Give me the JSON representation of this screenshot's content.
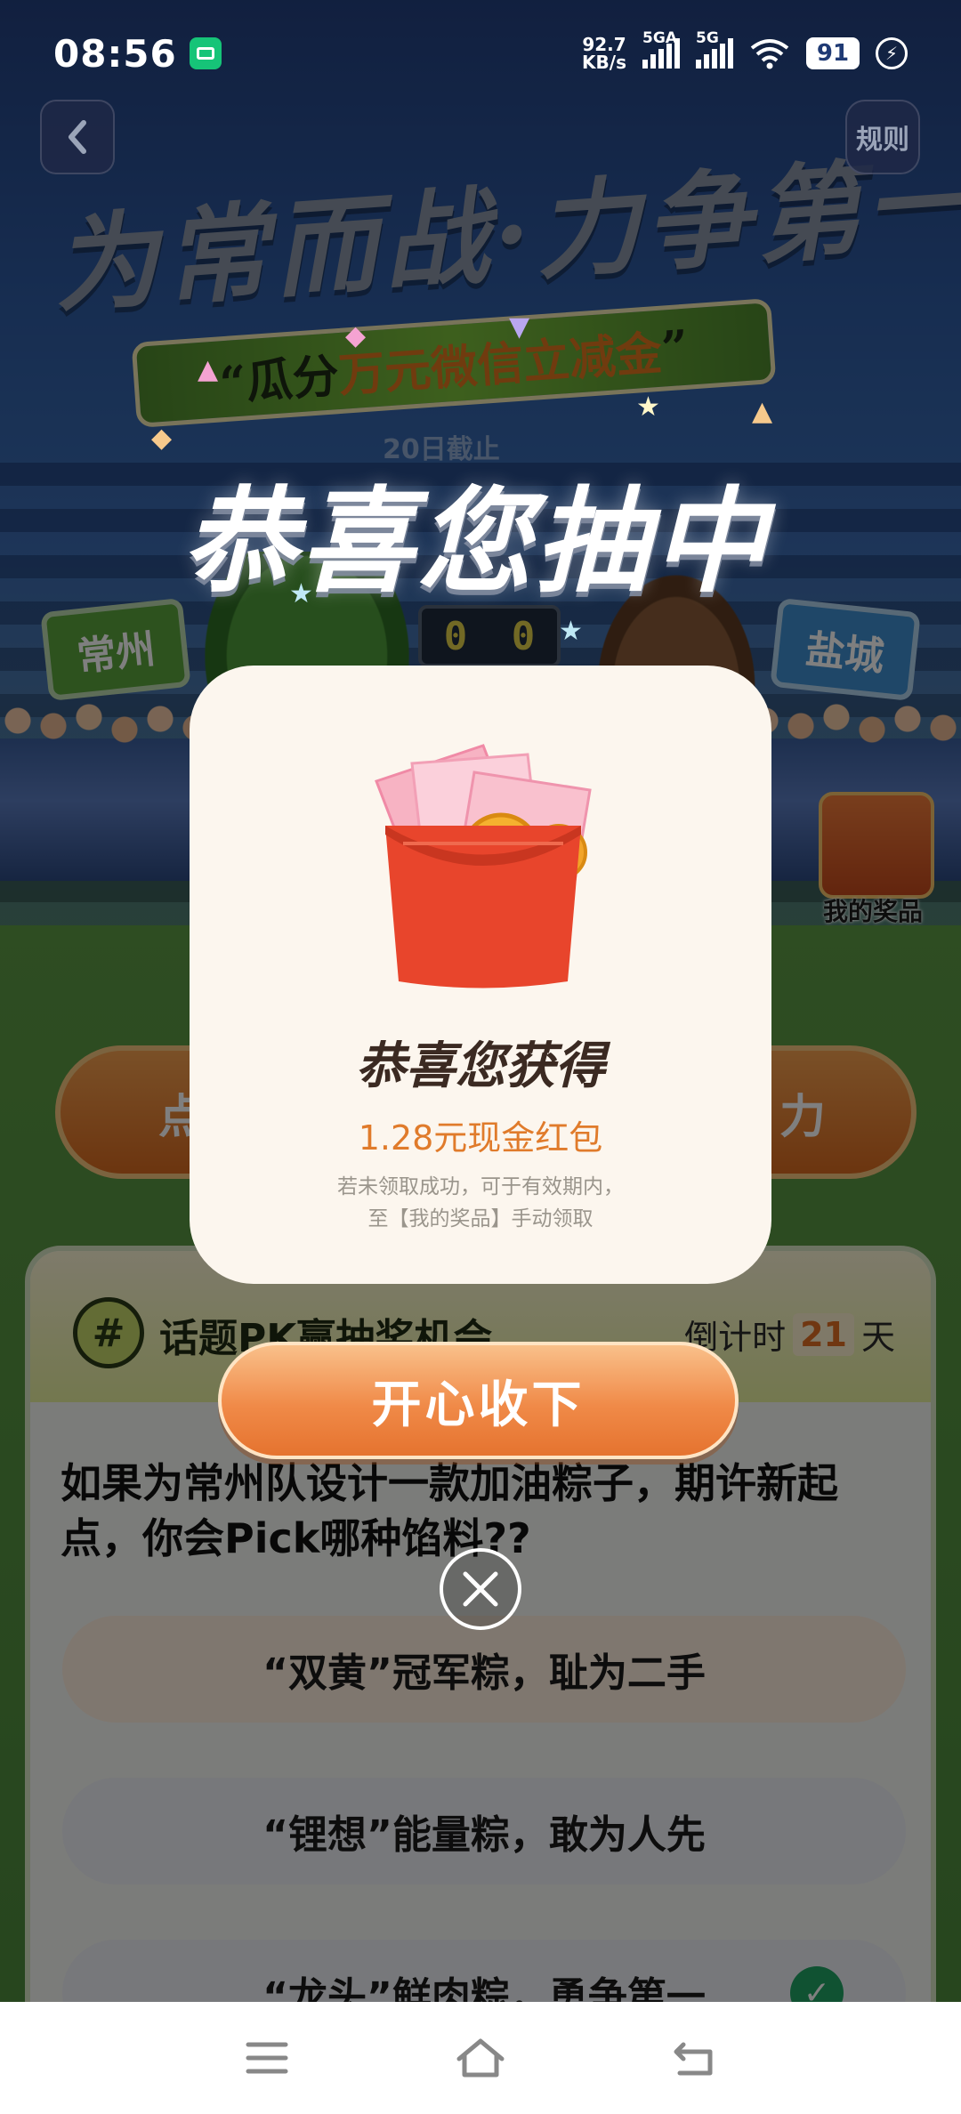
{
  "status_bar": {
    "time": "08:56",
    "net_speed_value": "92.7",
    "net_speed_unit": "KB/s",
    "signal1_label": "5GA",
    "signal2_label": "5G",
    "battery": "91",
    "icons": [
      "app-notification-icon",
      "wifi-icon",
      "charging-icon"
    ]
  },
  "top_nav": {
    "back_icon": "chevron-left-icon",
    "rules_label": "规则"
  },
  "background": {
    "headline": "为常而战·力争第一",
    "ribbon_prefix": "“瓜分",
    "ribbon_highlight": "万元微信立减金",
    "ribbon_suffix": "”",
    "deadline": "20日截止",
    "team_left": "常州",
    "team_right": "盐城",
    "score_left": "0",
    "score_right": "0",
    "my_prizes_label": "我的奖品",
    "button_left_text": "点",
    "button_right_text": "力",
    "panel": {
      "hash": "#",
      "title": "话题PK赢抽奖机会",
      "countdown_prefix": "倒计时",
      "countdown_days": "21",
      "countdown_suffix": "天",
      "question": "如果为常州队设计一款加油粽子，期许新起点，你会Pick哪种馅料??",
      "options": [
        "“双黄”冠军粽，耻为二手",
        "“锂想”能量粽，敢为人先",
        "“龙头”鲜肉粽，勇争第一"
      ]
    }
  },
  "modal": {
    "title": "恭喜您抽中",
    "heading": "恭喜您获得",
    "amount": "1.28元现金红包",
    "note_line1": "若未领取成功，可于有效期内，",
    "note_line2": "至【我的奖品】手动领取",
    "accept_label": "开心收下",
    "close_icon": "close-circle-icon",
    "envelope_icon": "red-envelope-icon"
  },
  "nav_bar": {
    "icons": [
      "menu-icon",
      "home-icon",
      "back-icon"
    ]
  },
  "colors": {
    "accent_orange": "#e07b2b",
    "modal_bg": "#fcf6ee",
    "check_green": "#21a464"
  }
}
